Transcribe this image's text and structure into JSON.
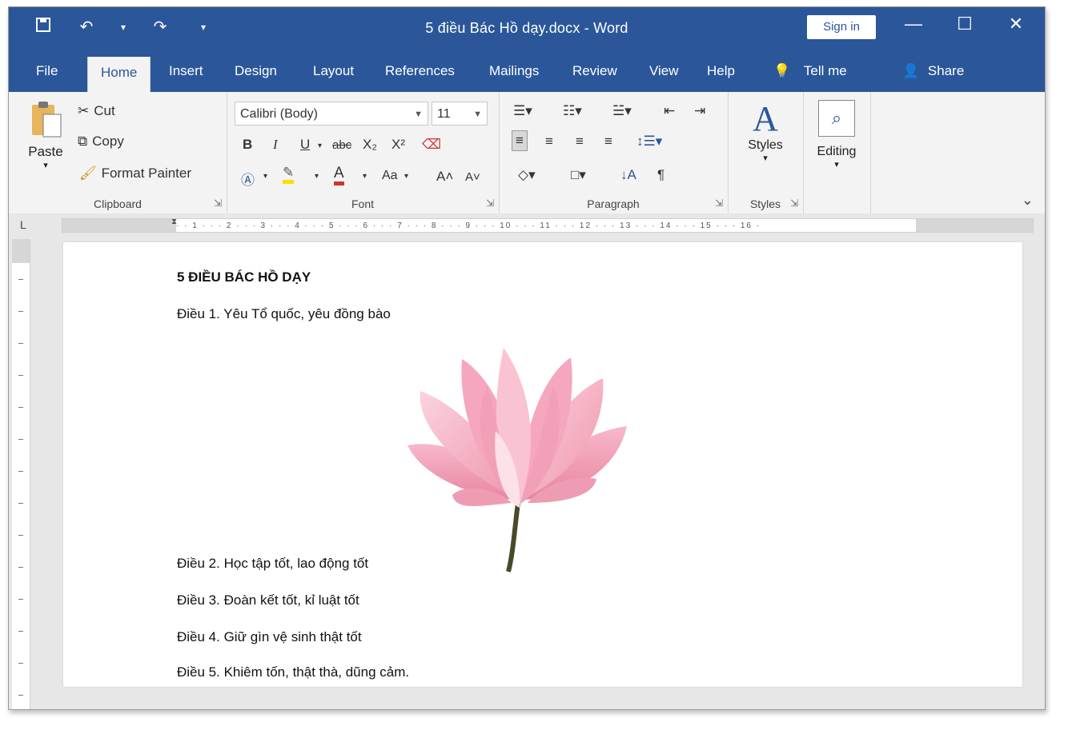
{
  "window": {
    "title": "5 điều Bác Hồ dạy.docx  -  Word",
    "sign_in_label": "Sign in",
    "controls": {
      "minimize": "—",
      "maximize": "☐",
      "close": "✕"
    }
  },
  "quick_access": {
    "save_icon": "save-icon",
    "undo_icon": "undo-icon",
    "redo_icon": "redo-icon",
    "customize_icon": "customize-qat-icon"
  },
  "tabs": [
    "File",
    "Home",
    "Insert",
    "Design",
    "Layout",
    "References",
    "Mailings",
    "Review",
    "View",
    "Help"
  ],
  "tell_me": "Tell me",
  "share": "Share",
  "ribbon": {
    "clipboard": {
      "paste": "Paste",
      "cut": "Cut",
      "copy": "Copy",
      "format_painter": "Format Painter",
      "label": "Clipboard"
    },
    "font": {
      "font_name": "Calibri (Body)",
      "font_size": "11",
      "label": "Font",
      "bold": "B",
      "italic": "I",
      "underline": "U",
      "strike": "abc",
      "subscript": "X₂",
      "superscript": "X²",
      "change_case": "Aa",
      "grow": "A˄",
      "shrink": "A˅"
    },
    "paragraph": {
      "label": "Paragraph",
      "pilcrow": "¶"
    },
    "styles": {
      "label": "Styles",
      "button": "Styles"
    },
    "editing": {
      "button": "Editing"
    }
  },
  "document": {
    "lines": [
      "5 ĐIỀU BÁC HỒ DẠY",
      "Điều 1. Yêu Tổ quốc, yêu đồng bào",
      "Điều 2. Học tập tốt, lao động tốt",
      "Điều 3. Đoàn kết tốt, kỉ luật tốt",
      "Điều 4. Giữ gìn vệ sinh thật tốt",
      "Điều 5. Khiêm tốn, thật thà, dũng cảm."
    ],
    "image": "lotus-flower"
  },
  "colors": {
    "accent": "#2b579a",
    "ribbon_bg": "#f3f3f3",
    "page_bg": "#ffffff",
    "lotus_pink": "#f3a6bd"
  }
}
